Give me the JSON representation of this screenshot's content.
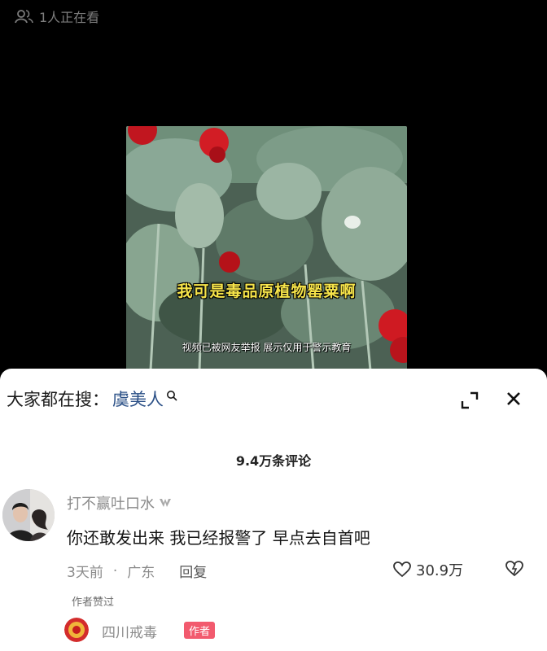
{
  "top_bar": {
    "viewers_text": "1人正在看",
    "icon": "viewers-icon"
  },
  "video": {
    "caption_main": "我可是毒品原植物罂粟啊",
    "caption_sub": "视频已被网友举报 展示仅用于警示教育"
  },
  "comments_panel": {
    "search_prefix": "大家都在搜：",
    "search_keyword": "虞美人",
    "comment_count": "9.4万条评论",
    "comment": {
      "username": "打不赢吐口水",
      "text": "你还敢发出来  我已经报警了 早点去自首吧",
      "time": "3天前",
      "location": "广东",
      "reply_label": "回复",
      "likes": "30.9万",
      "author_liked": "作者赞过"
    },
    "reply": {
      "username": "四川戒毒",
      "author_tag": "作者"
    }
  },
  "colors": {
    "background": "#000000",
    "panel": "#ffffff",
    "keyword": "#2a4f86",
    "caption": "#f6e44a",
    "author_tag": "#f25a6e"
  }
}
